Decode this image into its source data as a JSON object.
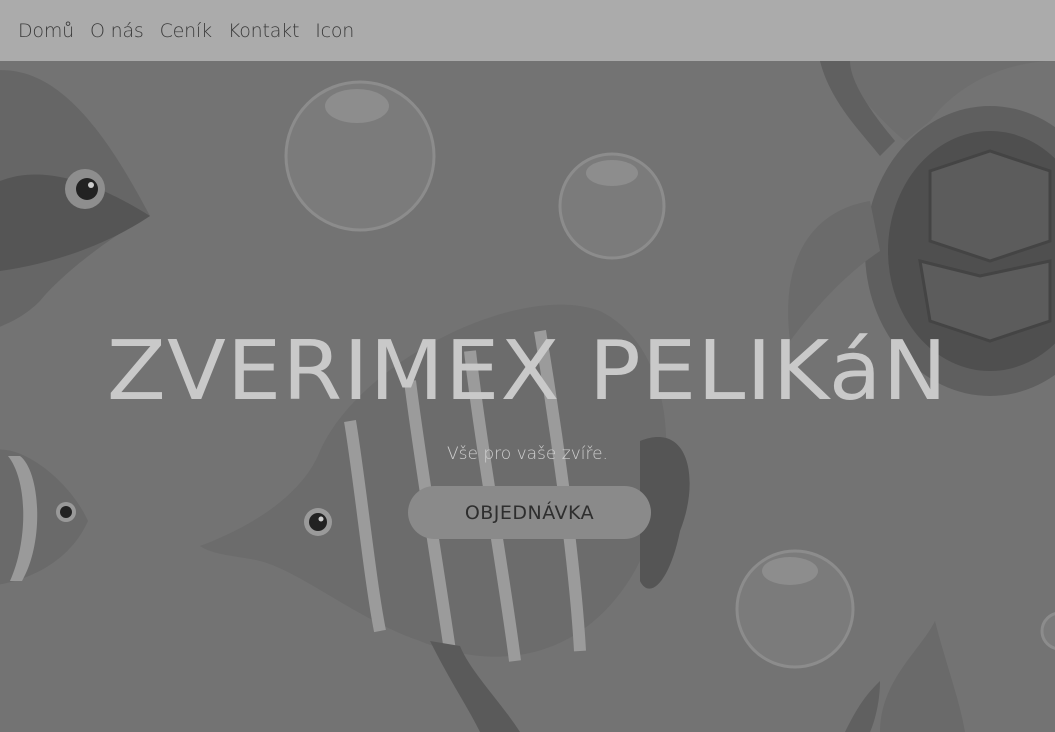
{
  "nav": {
    "items": [
      {
        "label": "Domů"
      },
      {
        "label": "O nás"
      },
      {
        "label": "Ceník"
      },
      {
        "label": "Kontakt"
      },
      {
        "label": "Icon"
      }
    ]
  },
  "hero": {
    "title": "ZVERIMEX PELIKáN",
    "subtitle": "Vše pro vaše zvíře.",
    "cta_label": "OBJEDNÁVKA"
  }
}
